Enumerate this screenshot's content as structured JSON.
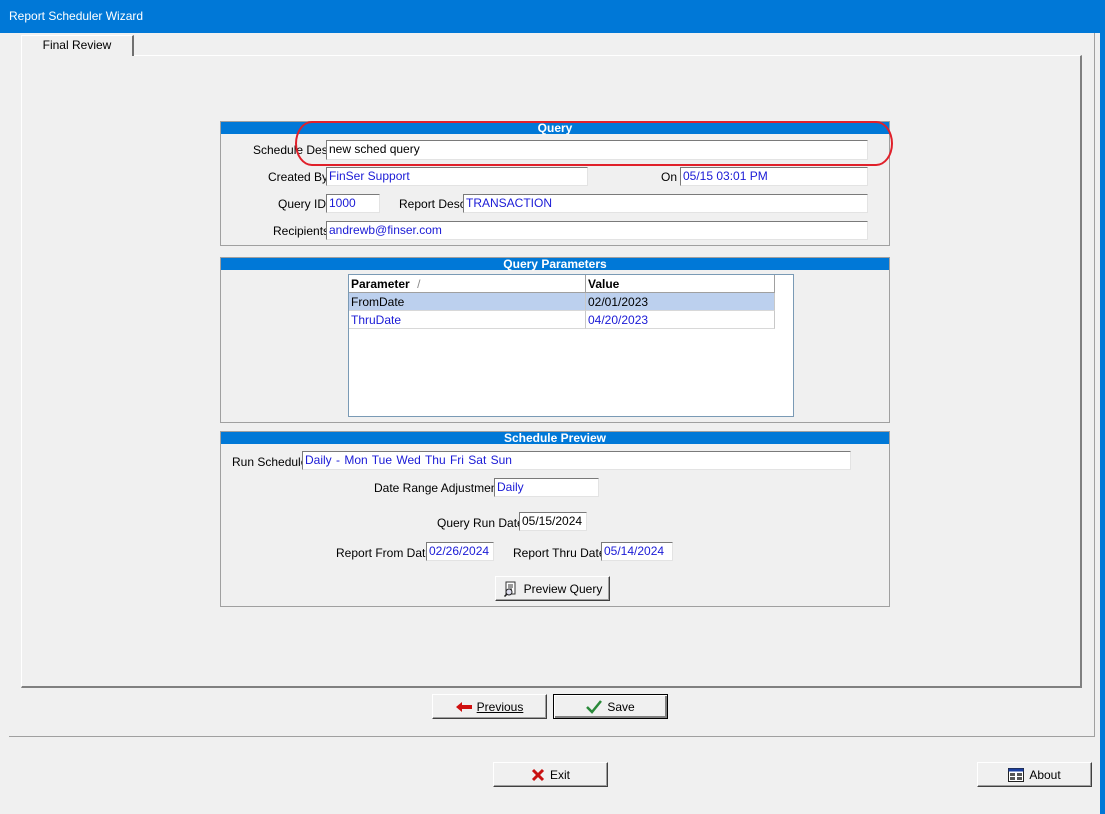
{
  "window": {
    "title": "Report Scheduler Wizard"
  },
  "tabs": [
    {
      "label": "Final Review"
    }
  ],
  "query": {
    "header": "Query",
    "schedule_desc_label": "Schedule Desc",
    "schedule_desc": "new sched query",
    "created_by_label": "Created By",
    "created_by": "FinSer Support",
    "on_label": "On",
    "on_value": "05/15 03:01 PM",
    "query_id_label": "Query ID",
    "query_id": "1000",
    "report_desc_label": "Report Desc",
    "report_desc": "TRANSACTION",
    "recipients_label": "Recipients",
    "recipients": "andrewb@finser.com"
  },
  "query_parameters": {
    "header": "Query Parameters",
    "columns": [
      "Parameter",
      "Value"
    ],
    "sort_indicator": "/",
    "rows": [
      {
        "parameter": "FromDate",
        "value": "02/01/2023",
        "selected": true
      },
      {
        "parameter": "ThruDate",
        "value": "04/20/2023",
        "selected": false
      }
    ]
  },
  "schedule_preview": {
    "header": "Schedule Preview",
    "run_schedule_label": "Run Schedule",
    "run_schedule": "Daily - Mon Tue Wed Thu Fri Sat Sun",
    "date_range_adjustment_label": "Date Range Adjustment",
    "date_range_adjustment": "Daily",
    "query_run_date_label": "Query Run Date",
    "query_run_date": "05/15/2024",
    "report_from_date_label": "Report From Date",
    "report_from_date": "02/26/2024",
    "report_thru_date_label": "Report Thru Date",
    "report_thru_date": "05/14/2024",
    "preview_button": "Preview Query"
  },
  "nav": {
    "previous": "Previous",
    "save": "Save"
  },
  "footer": {
    "exit": "Exit",
    "about": "About"
  },
  "colors": {
    "accent": "#0078d7",
    "highlight": "#e0202a",
    "value_text": "#1a1ad6"
  }
}
